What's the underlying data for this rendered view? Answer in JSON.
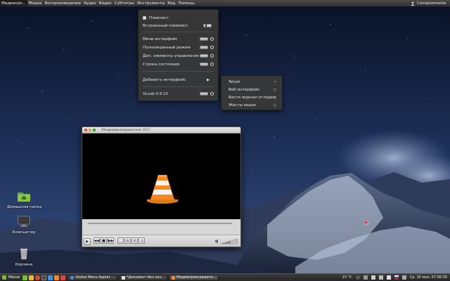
{
  "menubar": {
    "items": [
      {
        "label": "Медиапро...",
        "active": true
      },
      {
        "label": "Медиа"
      },
      {
        "label": "Воспроизведение"
      },
      {
        "label": "Аудио"
      },
      {
        "label": "Видео"
      },
      {
        "label": "Субтитры"
      },
      {
        "label": "Инструменты"
      },
      {
        "label": "Вид"
      },
      {
        "label": "Помощь"
      }
    ],
    "user": "Compizomania"
  },
  "view_menu": {
    "items": [
      {
        "label": "Плейлист",
        "control": "checkbox"
      },
      {
        "label": "Встроенный плейлист",
        "control": "switch-on"
      },
      {
        "label": "Мини-интерфейс",
        "control": "switch-radio"
      },
      {
        "label": "Полноэкранный режим",
        "control": "switch-radio"
      },
      {
        "label": "Доп. элементы управления",
        "control": "switch-radio"
      },
      {
        "label": "Строка состояния",
        "control": "switch-radio"
      },
      {
        "label": "Добавить интерфейс",
        "control": "submenu"
      },
      {
        "label": "VLsub 0.9.10",
        "control": "switch-radio"
      }
    ],
    "submenu_arrow": "▶"
  },
  "interfaces_submenu": {
    "items": [
      {
        "label": "Telnet",
        "indicator": "•"
      },
      {
        "label": "Веб-интерфейс",
        "indicator": "○"
      },
      {
        "label": "Вести журнал отладки",
        "indicator": "○"
      },
      {
        "label": "Жесты мыши",
        "indicator": "○"
      }
    ]
  },
  "vlc_window": {
    "title": "Медиапроигрыватель VLC",
    "time_elapsed": "",
    "time_total": "",
    "controls": [
      {
        "name": "play-button",
        "glyph": "▶"
      },
      {
        "name": "previous-button",
        "glyph": "◀◀"
      },
      {
        "name": "stop-button",
        "glyph": "■"
      },
      {
        "name": "next-button",
        "glyph": "▶▶"
      },
      {
        "name": "fullscreen-button",
        "glyph": "⛶"
      },
      {
        "name": "playlist-button",
        "glyph": "☰"
      },
      {
        "name": "loop-button",
        "glyph": "⟲"
      },
      {
        "name": "shuffle-button",
        "glyph": "⤨"
      }
    ]
  },
  "desktop_icons": [
    {
      "label": "Домашняя папка",
      "icon": "home-folder-icon"
    },
    {
      "label": "Компьютер",
      "icon": "computer-icon"
    },
    {
      "label": "Корзина",
      "icon": "trash-icon"
    }
  ],
  "taskbar": {
    "start_label": "Меню",
    "tasks": [
      {
        "label": "Global Menu Applet ...",
        "icon": "chrome-icon"
      },
      {
        "label": "*Документ без наз...",
        "icon": "text-editor-icon"
      },
      {
        "label": "Медиапроигрывате...",
        "icon": "vlc-icon",
        "active": true
      }
    ],
    "temperature": "15 °C",
    "clock": "Ср. 20 мая, 07:06:30"
  },
  "colors": {
    "accent_vlc": "#f5891f",
    "menu_bg": "#383838",
    "taskbar_bg": "#2e2e2e"
  }
}
